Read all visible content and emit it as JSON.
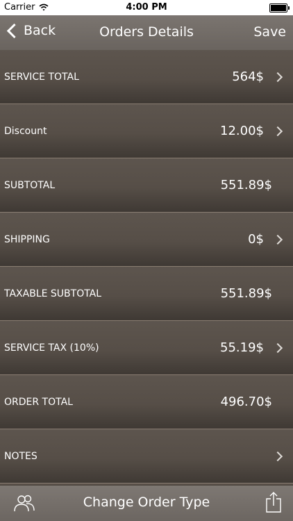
{
  "status_bar": {
    "carrier": "Carrier",
    "time": "4:00 PM"
  },
  "nav": {
    "back_label": "Back",
    "title": "Orders Details",
    "save_label": "Save"
  },
  "rows": [
    {
      "label": "SERVICE TOTAL",
      "value": "564$",
      "has_arrow": true
    },
    {
      "label": "Discount",
      "value": "12.00$",
      "has_arrow": true
    },
    {
      "label": "SUBTOTAL",
      "value": "551.89$",
      "has_arrow": false
    },
    {
      "label": "SHIPPING",
      "value": "0$",
      "has_arrow": true
    },
    {
      "label": "TAXABLE SUBTOTAL",
      "value": "551.89$",
      "has_arrow": false
    },
    {
      "label": "SERVICE TAX (10%)",
      "value": "55.19$",
      "has_arrow": true
    },
    {
      "label": "ORDER TOTAL",
      "value": "496.70$",
      "has_arrow": false
    },
    {
      "label": "NOTES",
      "value": "",
      "has_arrow": true
    }
  ],
  "toolbar": {
    "center_label": "Change Order Type",
    "left_icon": "people-icon",
    "right_icon": "share-icon"
  }
}
